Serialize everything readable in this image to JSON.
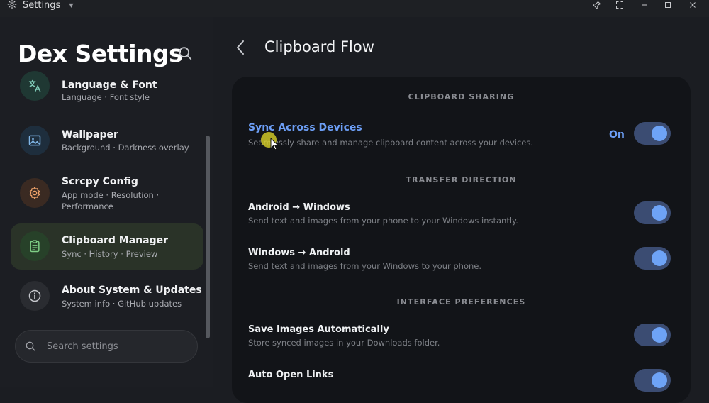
{
  "window": {
    "title": "Settings",
    "caret_icon": "dropdown-caret-icon",
    "controls": [
      "pin-icon",
      "fullscreen-icon",
      "minimize-icon",
      "maximize-icon",
      "close-icon"
    ]
  },
  "sidebar": {
    "title": "Dex Settings",
    "items": [
      {
        "label": "Language & Font",
        "sub": "Language · Font style",
        "icon": "translate-icon",
        "active": false
      },
      {
        "label": "Wallpaper",
        "sub": "Background · Darkness overlay",
        "icon": "image-icon",
        "active": false
      },
      {
        "label": "Scrcpy Config",
        "sub": "App mode · Resolution ·",
        "sub2": "Performance",
        "icon": "gear-icon",
        "active": false
      },
      {
        "label": "Clipboard Manager",
        "sub": "Sync · History · Preview",
        "icon": "clipboard-icon",
        "active": true
      },
      {
        "label": "About System & Updates",
        "sub": "System info · GitHub updates",
        "icon": "info-icon",
        "active": false
      }
    ],
    "search": {
      "placeholder": "Search settings",
      "value": ""
    }
  },
  "main": {
    "title": "Clipboard Flow",
    "sections": [
      {
        "heading": "CLIPBOARD SHARING",
        "rows": [
          {
            "title": "Sync Across Devices",
            "desc": "Seamlessly share and manage clipboard content across your devices.",
            "state_label": "On",
            "toggle": true
          }
        ]
      },
      {
        "heading": "TRANSFER DIRECTION",
        "rows": [
          {
            "title": "Android → Windows",
            "desc": "Send text and images from your phone to your Windows instantly.",
            "toggle": true
          },
          {
            "title": "Windows → Android",
            "desc": "Send text and images from your Windows to your phone.",
            "toggle": true
          }
        ]
      },
      {
        "heading": "INTERFACE PREFERENCES",
        "rows": [
          {
            "title": "Save Images Automatically",
            "desc": "Store synced images in your Downloads folder.",
            "toggle": true
          },
          {
            "title": "Auto Open Links",
            "desc": "",
            "toggle": true
          }
        ]
      }
    ]
  },
  "colors": {
    "accent": "#6c9ef5",
    "toggle_track": "#3b4c72",
    "active_item_bg": "#2a3328",
    "card_bg": "#121418"
  }
}
